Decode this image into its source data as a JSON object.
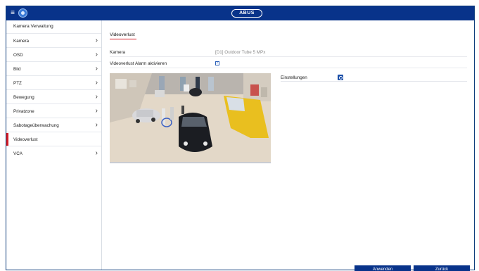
{
  "header": {
    "logo_text": "ABUS",
    "menu_icon": "hamburger-icon",
    "home_icon": "home-icon"
  },
  "sidebar": {
    "title": "Kamera Verwaltung",
    "items": [
      {
        "label": "Kamera",
        "has_chevron": true
      },
      {
        "label": "OSD",
        "has_chevron": true
      },
      {
        "label": "Bild",
        "has_chevron": true
      },
      {
        "label": "PTZ",
        "has_chevron": true
      },
      {
        "label": "Bewegung",
        "has_chevron": true
      },
      {
        "label": "Privatzone",
        "has_chevron": true
      },
      {
        "label": "Sabotageüberwachung",
        "has_chevron": true
      },
      {
        "label": "Videoverlust",
        "has_chevron": false,
        "active": true
      },
      {
        "label": "VCA",
        "has_chevron": true
      }
    ]
  },
  "main": {
    "tab": "Videoverlust",
    "camera_label": "Kamera",
    "camera_value": "[D1] Outdoor Tube 5 MPx",
    "alarm_label": "Videoverlust Alarm aktivieren",
    "alarm_checked": true,
    "settings_label": "Einstellungen"
  },
  "footer": {
    "apply": "Anwenden",
    "back": "Zurück"
  },
  "colors": {
    "brand_blue": "#08338a",
    "accent_red": "#d41b24"
  }
}
